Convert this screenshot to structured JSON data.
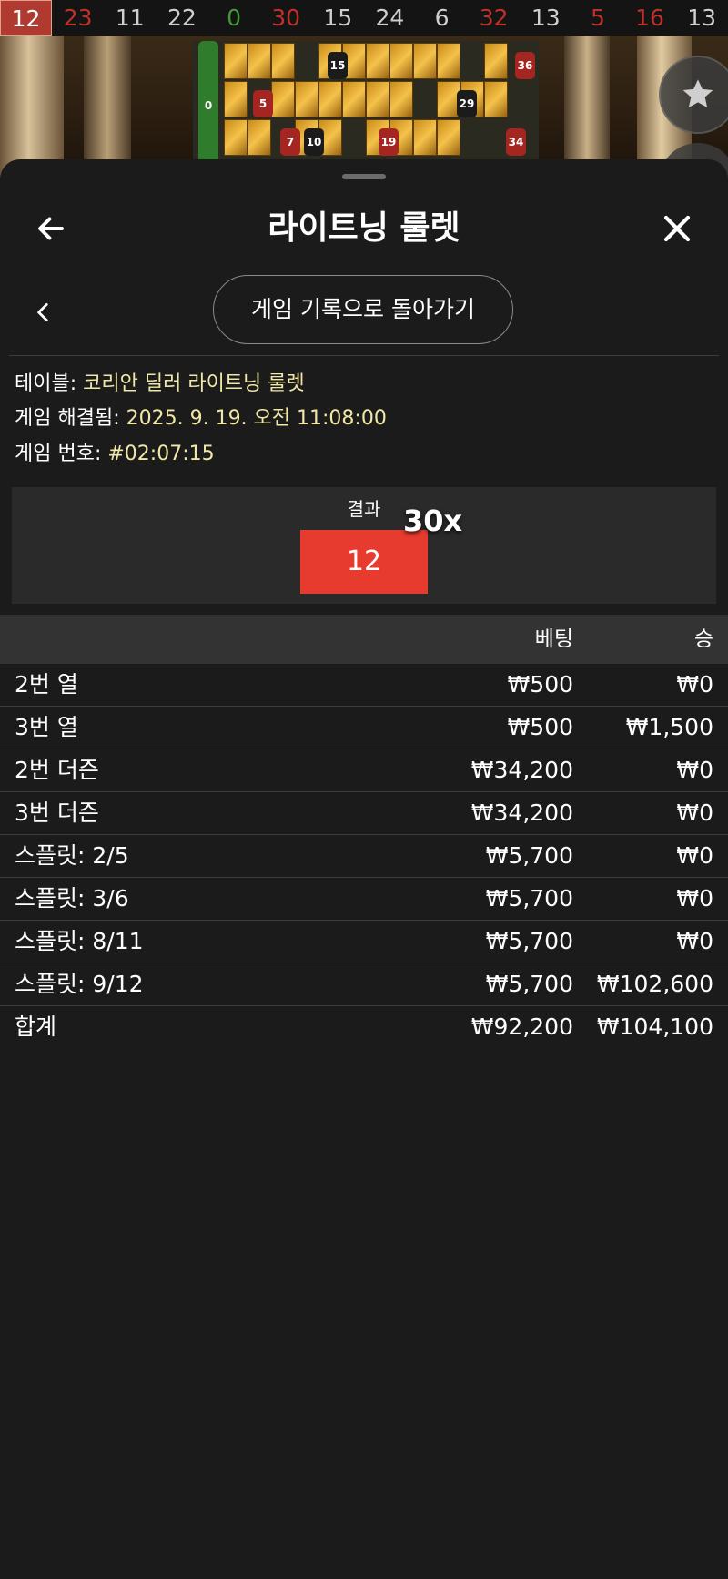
{
  "history": {
    "numbers": [
      {
        "value": "12",
        "color": "red"
      },
      {
        "value": "23",
        "color": "red"
      },
      {
        "value": "11",
        "color": "black"
      },
      {
        "value": "22",
        "color": "black"
      },
      {
        "value": "0",
        "color": "green"
      },
      {
        "value": "30",
        "color": "red"
      },
      {
        "value": "15",
        "color": "black"
      },
      {
        "value": "24",
        "color": "black"
      },
      {
        "value": "6",
        "color": "black"
      },
      {
        "value": "32",
        "color": "red"
      },
      {
        "value": "13",
        "color": "black"
      },
      {
        "value": "5",
        "color": "red"
      },
      {
        "value": "16",
        "color": "red"
      },
      {
        "value": "13",
        "color": "black"
      }
    ]
  },
  "scene": {
    "board_chips": [
      "0",
      "15",
      "36",
      "5",
      "29",
      "7",
      "10",
      "19",
      "34"
    ]
  },
  "sheet": {
    "title": "라이트닝 룰렛",
    "back_icon": "arrow-left-icon",
    "close_icon": "close-icon",
    "history_button": "게임 기록으로 돌아가기"
  },
  "info": {
    "table_label": "테이블: ",
    "table_value": "코리안 딜러 라이트닝 룰렛",
    "resolved_label": "게임 해결됨: ",
    "resolved_value": "2025. 9. 19. 오전 11:08:00",
    "game_no_label": "게임 번호: ",
    "game_no_value": "#02:07:15"
  },
  "result": {
    "label": "결과",
    "number": "12",
    "multiplier": "30x",
    "color": "#e63b2e"
  },
  "bets": {
    "header_bet": "베팅",
    "header_win": "승",
    "rows": [
      {
        "name": "2번 열",
        "bet": "₩500",
        "win": "₩0"
      },
      {
        "name": "3번 열",
        "bet": "₩500",
        "win": "₩1,500"
      },
      {
        "name": "2번 더즌",
        "bet": "₩34,200",
        "win": "₩0"
      },
      {
        "name": "3번 더즌",
        "bet": "₩34,200",
        "win": "₩0"
      },
      {
        "name": "스플릿: 2/5",
        "bet": "₩5,700",
        "win": "₩0"
      },
      {
        "name": "스플릿: 3/6",
        "bet": "₩5,700",
        "win": "₩0"
      },
      {
        "name": "스플릿: 8/11",
        "bet": "₩5,700",
        "win": "₩0"
      },
      {
        "name": "스플릿: 9/12",
        "bet": "₩5,700",
        "win": "₩102,600"
      }
    ],
    "total": {
      "name": "합계",
      "bet": "₩92,200",
      "win": "₩104,100"
    }
  }
}
